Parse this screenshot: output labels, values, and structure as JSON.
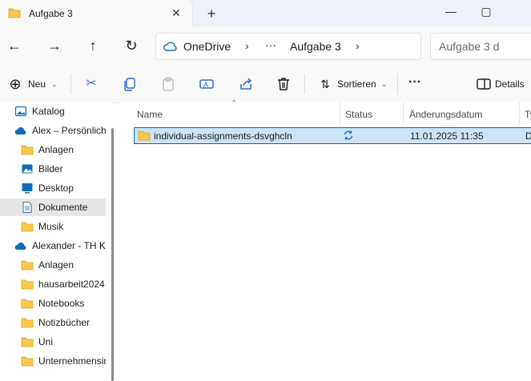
{
  "tab": {
    "title": "Aufgabe 3",
    "close": "✕",
    "new_tab": "+"
  },
  "window": {
    "minimize": "—",
    "maximize": "▢"
  },
  "nav": {
    "back": "←",
    "forward": "→",
    "up": "↑",
    "refresh": "↻"
  },
  "address": {
    "crumbs": [
      "OneDrive",
      "Aufgabe 3"
    ],
    "more": "···",
    "sep": "›"
  },
  "search": {
    "placeholder": "Aufgabe 3 d"
  },
  "commands": {
    "new_label": "Neu",
    "sort_label": "Sortieren",
    "more": "···",
    "details_label": "Details"
  },
  "sidebar": {
    "items": [
      {
        "label": "Katalog",
        "icon": "gallery-icon"
      },
      {
        "label": "Alex – Persönlich",
        "icon": "onedrive-cloud-icon"
      },
      {
        "label": "Anlagen",
        "icon": "folder-icon"
      },
      {
        "label": "Bilder",
        "icon": "pictures-icon"
      },
      {
        "label": "Desktop",
        "icon": "desktop-icon"
      },
      {
        "label": "Dokumente",
        "icon": "documents-icon",
        "selected": true
      },
      {
        "label": "Musik",
        "icon": "folder-icon"
      },
      {
        "label": "Alexander - TH Kö",
        "icon": "onedrive-cloud-icon"
      },
      {
        "label": "Anlagen",
        "icon": "folder-icon"
      },
      {
        "label": "hausarbeit2024",
        "icon": "folder-icon"
      },
      {
        "label": "Notebooks",
        "icon": "folder-icon"
      },
      {
        "label": "Notizbücher",
        "icon": "folder-icon"
      },
      {
        "label": "Uni",
        "icon": "folder-icon"
      },
      {
        "label": "Unternehmensin",
        "icon": "folder-icon"
      }
    ]
  },
  "columns": {
    "name": "Name",
    "status": "Status",
    "date": "Änderungsdatum",
    "type": "Ty"
  },
  "rows": [
    {
      "name": "individual-assignments-dsvghcln",
      "status": "sync-icon",
      "date": "11.01.2025 11:35",
      "type": "D"
    }
  ],
  "colors": {
    "accent": "#0067c0",
    "selection": "#cce4f7",
    "folder": "#f8c84a",
    "cloud": "#0f6cbd"
  }
}
